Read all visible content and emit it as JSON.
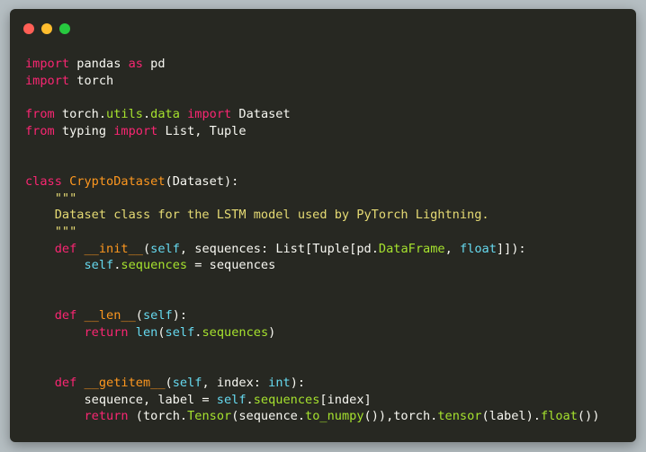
{
  "colors": {
    "background": "#b5bec2",
    "editor_bg": "#272822",
    "close": "#ff5f56",
    "minimize": "#ffbd2e",
    "maximize": "#27c93f"
  },
  "window_controls": [
    {
      "name": "close",
      "icon": "close-dot"
    },
    {
      "name": "minimize",
      "icon": "minimize-dot"
    },
    {
      "name": "maximize",
      "icon": "maximize-dot"
    }
  ],
  "code": {
    "language": "python",
    "lines": [
      "import pandas as pd",
      "import torch",
      "",
      "from torch.utils.data import Dataset",
      "from typing import List, Tuple",
      "",
      "",
      "class CryptoDataset(Dataset):",
      "    \"\"\"",
      "    Dataset class for the LSTM model used by PyTorch Lightning.",
      "    \"\"\"",
      "    def __init__(self, sequences: List[Tuple[pd.DataFrame, float]]):",
      "        self.sequences = sequences",
      "",
      "",
      "    def __len__(self):",
      "        return len(self.sequences)",
      "",
      "",
      "    def __getitem__(self, index: int):",
      "        sequence, label = self.sequences[index]",
      "        return (torch.Tensor(sequence.to_numpy()),torch.tensor(label).float())"
    ]
  }
}
